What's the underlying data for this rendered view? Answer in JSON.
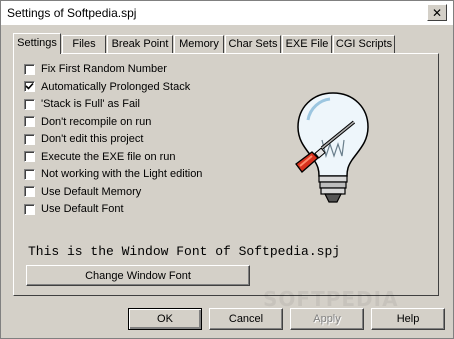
{
  "window": {
    "title": "Settings of Softpedia.spj",
    "close_glyph": "✕"
  },
  "tabs": [
    {
      "label": "Settings",
      "active": true
    },
    {
      "label": "Files",
      "active": false
    },
    {
      "label": "Break Point",
      "active": false
    },
    {
      "label": "Memory",
      "active": false
    },
    {
      "label": "Char Sets",
      "active": false
    },
    {
      "label": "EXE File",
      "active": false
    },
    {
      "label": "CGI Scripts",
      "active": false
    }
  ],
  "options": [
    {
      "label": "Fix First Random Number",
      "checked": false
    },
    {
      "label": "Automatically Prolonged Stack",
      "checked": true
    },
    {
      "label": "'Stack is Full' as Fail",
      "checked": false
    },
    {
      "label": "Don't recompile on run",
      "checked": false
    },
    {
      "label": "Don't edit this project",
      "checked": false
    },
    {
      "label": "Execute the EXE file on run",
      "checked": false
    },
    {
      "label": "Not working with the Light edition",
      "checked": false
    },
    {
      "label": "Use Default Memory",
      "checked": false
    },
    {
      "label": "Use Default Font",
      "checked": false
    }
  ],
  "illustration": {
    "icon": "lightbulb-screwdriver-icon"
  },
  "font_sample": "This is the Window Font of Softpedia.spj",
  "change_font_button": "Change Window Font",
  "footer": {
    "ok": "OK",
    "cancel": "Cancel",
    "apply": "Apply",
    "help": "Help"
  },
  "watermark": "SOFTPEDIA"
}
